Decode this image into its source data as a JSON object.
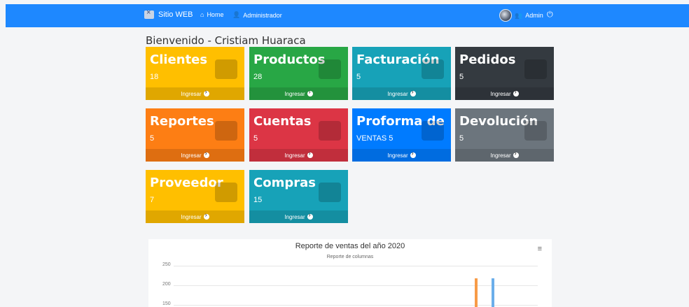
{
  "nav": {
    "brand": "Sitio WEB",
    "home": "Home",
    "admin": "Administrador",
    "user": "Admin",
    "power": "⏻"
  },
  "welcome": "Bienvenido - Cristiam  Huaraca",
  "cards": [
    {
      "title": "Clientes",
      "count": "18",
      "link": "Ingresar",
      "color": "#ffbf00",
      "icon": "user-plus-icon"
    },
    {
      "title": "Productos",
      "count": "28",
      "link": "Ingresar",
      "color": "#28a745",
      "icon": "lightbulb-icon"
    },
    {
      "title": "Facturación",
      "count": "5",
      "link": "Ingresar",
      "color": "#17a2b8",
      "icon": "printer-icon"
    },
    {
      "title": "Pedidos",
      "count": "5",
      "link": "Ingresar",
      "color": "#343a40",
      "icon": "truck-icon"
    },
    {
      "title": "Reportes",
      "count": "5",
      "link": "Ingresar",
      "color": "#fd7e14",
      "icon": "report-icon"
    },
    {
      "title": "Cuentas",
      "count": "5",
      "link": "Ingresar",
      "color": "#dc3545",
      "icon": "dollar-icon"
    },
    {
      "title": "Proforma de",
      "count": "VENTAS 5",
      "link": "Ingresar",
      "color": "#007bff",
      "icon": "invoice-icon"
    },
    {
      "title": "Devolución",
      "count": "5",
      "link": "Ingresar",
      "color": "#6c757d",
      "icon": "exchange-icon"
    },
    {
      "title": "Proveedor",
      "count": "7",
      "link": "Ingresar",
      "color": "#ffbf00",
      "icon": "user-plus-icon"
    },
    {
      "title": "Compras",
      "count": "15",
      "link": "Ingresar",
      "color": "#17a2b8",
      "icon": "printer-icon"
    }
  ],
  "chart_data": {
    "type": "bar",
    "title": "Reporte de ventas del año 2020",
    "subtitle": "Reporte de columnas",
    "yticks": [
      "250",
      "200",
      "150"
    ],
    "ylim": [
      0,
      250
    ],
    "series": [
      {
        "values": [
          217
        ],
        "color": "#f79b47"
      },
      {
        "values": [
          217
        ],
        "color": "#6baeea"
      }
    ],
    "menu": "≡"
  }
}
